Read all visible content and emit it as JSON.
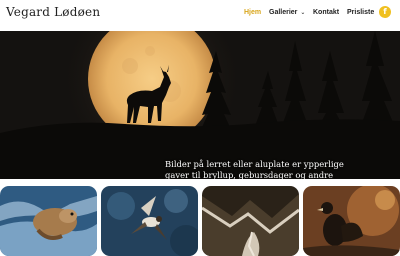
{
  "site": {
    "title": "Vegard Lødøen"
  },
  "nav": {
    "items": [
      {
        "label": "Hjem",
        "active": true
      },
      {
        "label": "Gallerier",
        "dropdown": true
      },
      {
        "label": "Kontakt"
      },
      {
        "label": "Prisliste"
      }
    ],
    "facebook_icon": "facebook-icon",
    "facebook_glyph": "f"
  },
  "hero": {
    "caption": "Bilder på lerret eller aluplate er ypperlige gaver til bryllup, gebursdager og andre jubilanter, markeringer"
  },
  "gallery": {
    "thumbnails": [
      "otter-photo",
      "bird-in-flight-photo",
      "mountain-stream-photo",
      "capercaillie-photo"
    ]
  },
  "colors": {
    "accent": "#d8a51a",
    "facebook": "#f0c020",
    "text": "#222222"
  }
}
